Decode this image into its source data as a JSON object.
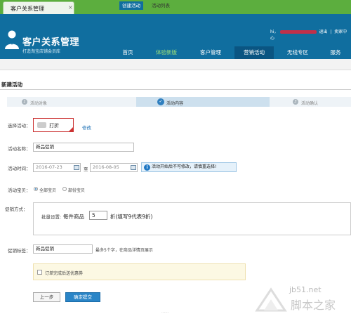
{
  "browser_tab": {
    "title": "客户关系管理",
    "close": "×"
  },
  "header": {
    "app_title": "客户关系管理",
    "app_subtitle": "打造淘宝店铺会员库",
    "user": {
      "greeting": "hi，",
      "logout": "退出",
      "seller_center": "卖家中心"
    },
    "nav": [
      "首页",
      "体验新版",
      "客户管理",
      "营销活动",
      "无线专区",
      "服务"
    ],
    "nav_active": "营销活动",
    "brand_color": "#106e9f"
  },
  "subnav": [
    "创建活动",
    "活动列表"
  ],
  "page_heading": "新建活动",
  "steps": [
    {
      "num": "1",
      "label": "活动对象"
    },
    {
      "num": "✓",
      "label": "活动内容"
    },
    {
      "num": "3",
      "label": "活动确认"
    }
  ],
  "form": {
    "select_activity_label": "选择活动：",
    "activity_value": "打折",
    "modify_link": "修改",
    "name_label": "活动名称：",
    "name_value": "新品促销",
    "time_label": "活动时间：",
    "start_date": "2016-07-23",
    "to": "至",
    "end_date": "2016-08-05",
    "time_notice": "活动开始后不可修改，请慎重选择!",
    "item_label": "活动宝贝：",
    "item_options": [
      "全部宝贝",
      "部份宝贝"
    ],
    "item_selected": "全部宝贝",
    "method_label": "促销方式：",
    "bulk_label": "批量设置:",
    "each_item": "每件商品",
    "discount_value": "5",
    "discount_hint": "折(填写9代表9折)",
    "tag_label": "促销标签：",
    "tag_value": "新品促销",
    "tag_hint": "最多5个字，在商品详情页展示",
    "coupon_checkbox_label": "订单完成后送优惠券",
    "coupon_checked": false,
    "prev_button": "上一步",
    "submit_button": "确定提交"
  },
  "footer_text": "......",
  "watermark": {
    "domain": "jb51.net",
    "name": "脚本之家"
  }
}
